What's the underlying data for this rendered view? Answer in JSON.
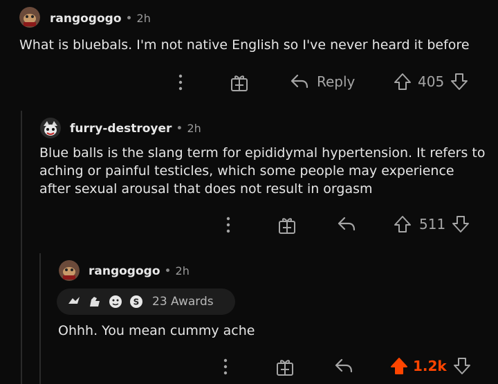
{
  "comments": [
    {
      "username": "rangogogo",
      "time": "2h",
      "text": "What is bluebals. I'm not native English so I've never heard it before",
      "reply_label": "Reply",
      "votes": "405"
    },
    {
      "username": "furry-destroyer",
      "time": "2h",
      "text": "Blue balls is the slang term for epididymal hypertension. It refers to aching or painful testicles, which some people may experience after sexual arousal that does not result in orgasm",
      "votes": "511"
    },
    {
      "username": "rangogogo",
      "time": "2h",
      "awards_label": "23 Awards",
      "text": "Ohhh. You mean cummy ache",
      "votes": "1.2k",
      "upvoted_color": "#ff4500"
    }
  ],
  "separator": "•"
}
